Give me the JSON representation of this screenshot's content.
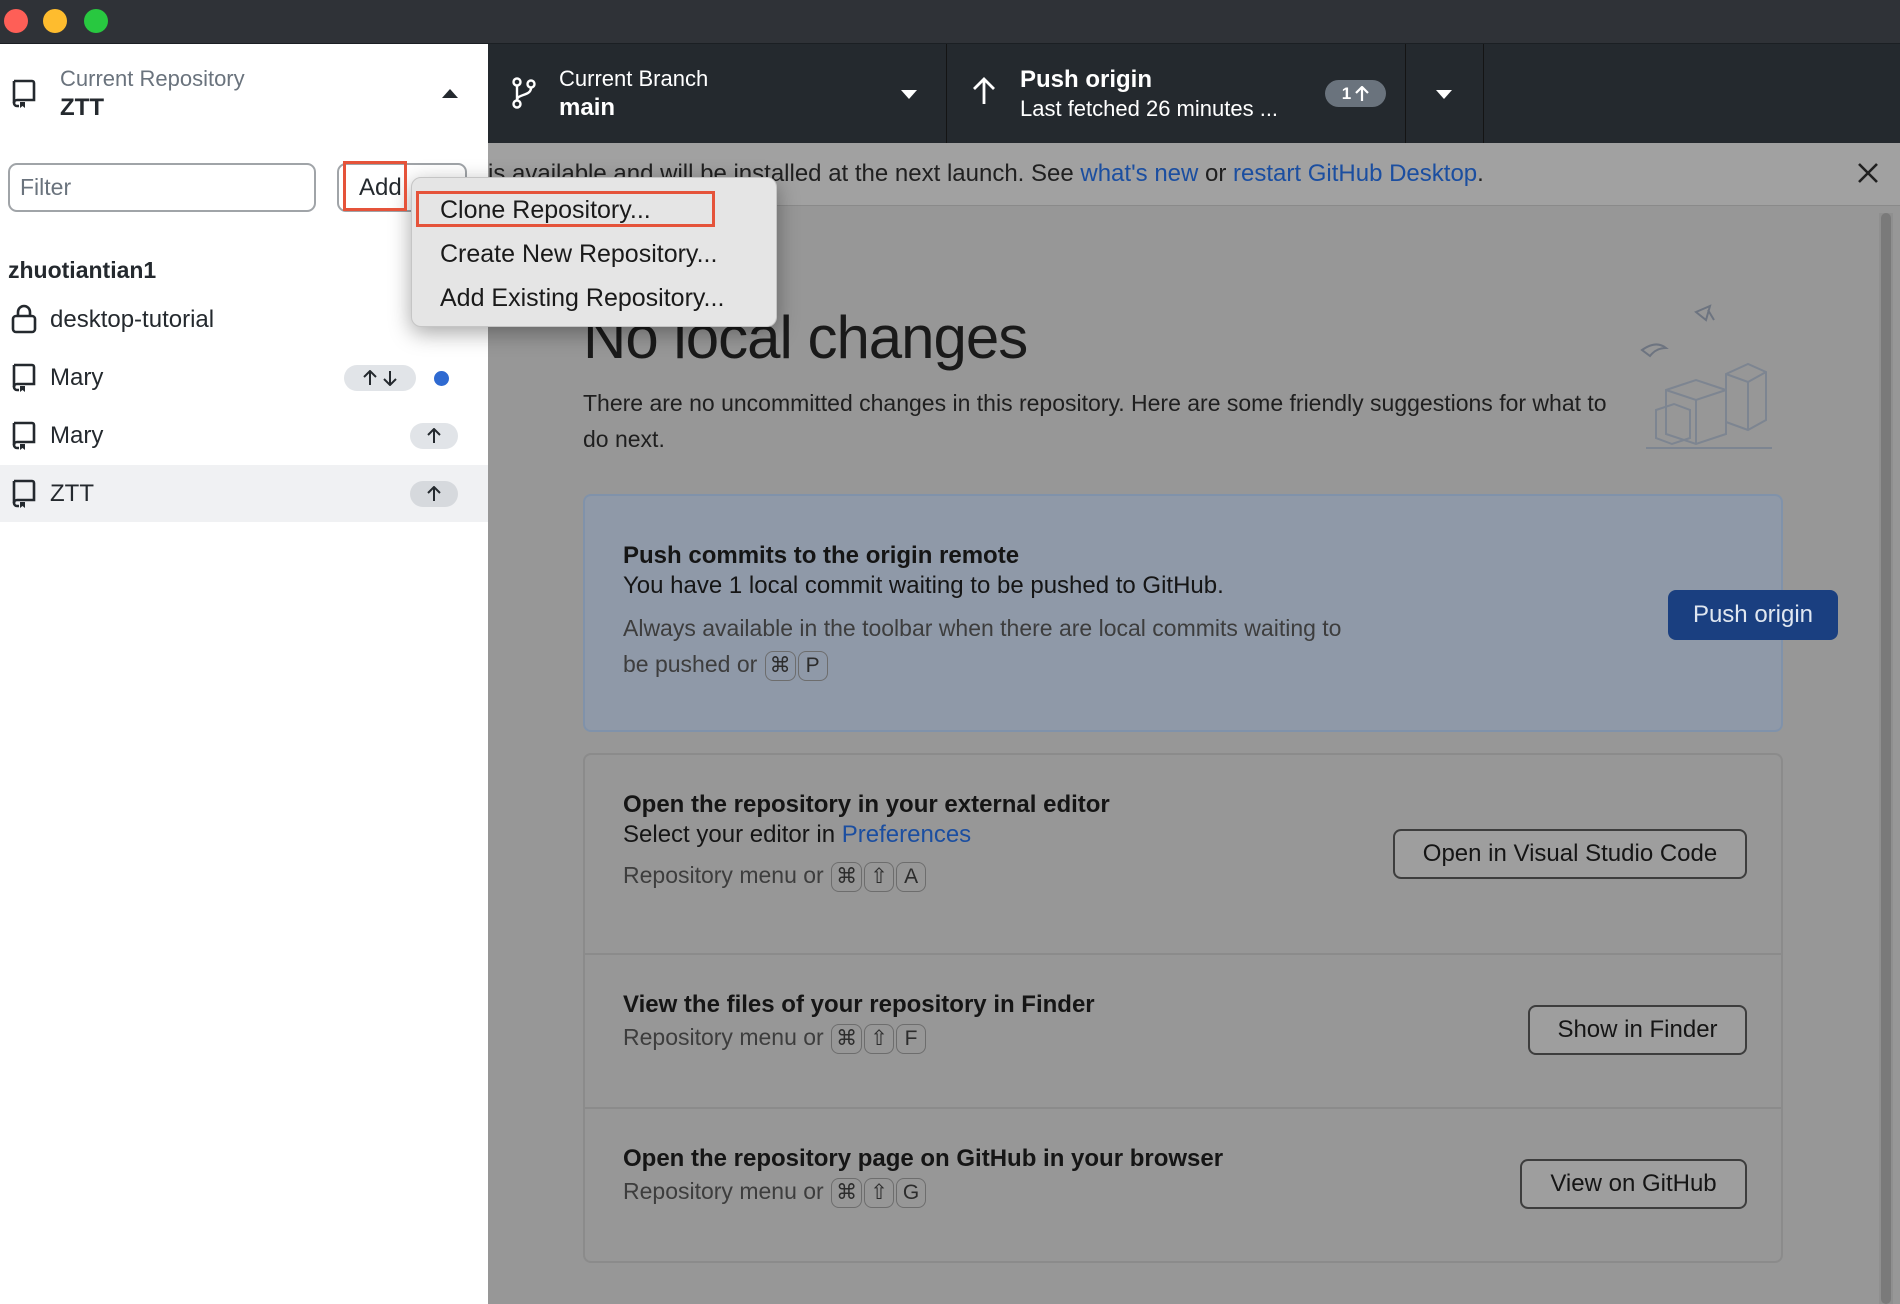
{
  "toolbar": {
    "repository_label": "Current Repository",
    "repository_name": "ZTT",
    "branch_label": "Current Branch",
    "branch_name": "main",
    "push_title": "Push origin",
    "push_subtitle": "Last fetched 26 minutes ...",
    "push_badge_count": "1"
  },
  "sidebar": {
    "filter_placeholder": "Filter",
    "add_label": "Add",
    "group_name": "zhuotiantian1",
    "repositories": [
      {
        "name": "desktop-tutorial",
        "icon": "lock-icon"
      },
      {
        "name": "Mary",
        "icon": "repo-icon",
        "status": "ahead-behind",
        "changes_dot": true
      },
      {
        "name": "Mary",
        "icon": "repo-icon",
        "status": "ahead"
      },
      {
        "name": "ZTT",
        "icon": "repo-icon",
        "status": "ahead",
        "selected": true
      }
    ]
  },
  "add_menu": {
    "items": [
      "Clone Repository...",
      "Create New Repository...",
      "Add Existing Repository..."
    ]
  },
  "banner": {
    "text_start": "is available and will be installed at the next launch. See",
    "link_whats_new": "what's new",
    "text_or": "or",
    "link_restart": "restart GitHub Desktop",
    "text_end": "."
  },
  "main": {
    "title": "No local changes",
    "description": "There are no uncommitted changes in this repository. Here are some friendly suggestions for what to do next.",
    "push_card": {
      "title": "Push commits to the origin remote",
      "description": "You have 1 local commit waiting to be pushed to GitHub.",
      "hint": "Always available in the toolbar when there are local commits waiting to be pushed or",
      "keys": [
        "⌘",
        "P"
      ],
      "button": "Push origin"
    },
    "editor_card": {
      "title": "Open the repository in your external editor",
      "description_start": "Select your editor in",
      "description_link": "Preferences",
      "hint": "Repository menu or",
      "keys": [
        "⌘",
        "⇧",
        "A"
      ],
      "button": "Open in Visual Studio Code"
    },
    "finder_card": {
      "title": "View the files of your repository in Finder",
      "hint": "Repository menu or",
      "keys": [
        "⌘",
        "⇧",
        "F"
      ],
      "button": "Show in Finder"
    },
    "github_card": {
      "title": "Open the repository page on GitHub in your browser",
      "hint": "Repository menu or",
      "keys": [
        "⌘",
        "⇧",
        "G"
      ],
      "button": "View on GitHub"
    }
  },
  "colors": {
    "accent_blue": "#2f6ad1",
    "annotation_red": "#e5533a",
    "toolbar_dark": "#24292e"
  }
}
